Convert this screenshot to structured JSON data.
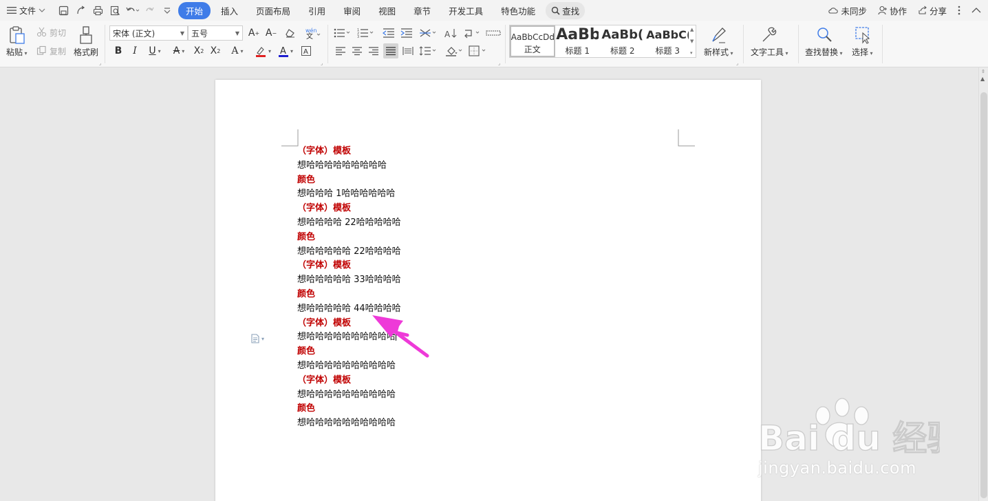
{
  "menu": {
    "file_label": "文件",
    "tabs": [
      "开始",
      "插入",
      "页面布局",
      "引用",
      "审阅",
      "视图",
      "章节",
      "开发工具",
      "特色功能"
    ],
    "active_tab": "开始",
    "search_label": "查找",
    "sync_label": "未同步",
    "collab_label": "协作",
    "share_label": "分享"
  },
  "ribbon": {
    "paste": "粘贴",
    "cut": "剪切",
    "copy": "复制",
    "format_painter": "格式刷",
    "font_name": "宋体 (正文)",
    "font_size": "五号",
    "styles": [
      {
        "preview": "AaBbCcDd",
        "name": "正文"
      },
      {
        "preview": "AaBb",
        "name": "标题 1"
      },
      {
        "preview": "AaBb(",
        "name": "标题 2"
      },
      {
        "preview": "AaBbC(",
        "name": "标题 3"
      }
    ],
    "new_style": "新样式",
    "text_tools": "文字工具",
    "find_replace": "查找替换",
    "select": "选择"
  },
  "document": {
    "lines": [
      {
        "text": "（字体）模板",
        "style": "red"
      },
      {
        "text": "想哈哈哈哈哈哈哈哈哈",
        "style": "black"
      },
      {
        "text": "颜色",
        "style": "red"
      },
      {
        "text": "想哈哈哈 1哈哈哈哈哈哈",
        "style": "black"
      },
      {
        "text": "（字体）模板",
        "style": "red"
      },
      {
        "text": "想哈哈哈哈 22哈哈哈哈哈",
        "style": "black"
      },
      {
        "text": "颜色",
        "style": "red"
      },
      {
        "text": "想哈哈哈哈哈 22哈哈哈哈",
        "style": "black"
      },
      {
        "text": "（字体）模板",
        "style": "red"
      },
      {
        "text": "想哈哈哈哈哈 33哈哈哈哈",
        "style": "black"
      },
      {
        "text": "颜色",
        "style": "red"
      },
      {
        "text": "想哈哈哈哈哈 44哈哈哈哈",
        "style": "black"
      },
      {
        "text": "（字体）模板",
        "style": "red"
      },
      {
        "text": "想哈哈哈哈哈哈哈哈哈哈",
        "style": "black"
      },
      {
        "text": "颜色",
        "style": "red"
      },
      {
        "text": "想哈哈哈哈哈哈哈哈哈哈",
        "style": "black"
      },
      {
        "text": "（字体）模板",
        "style": "red"
      },
      {
        "text": "想哈哈哈哈哈哈哈哈哈哈",
        "style": "black"
      },
      {
        "text": "颜色",
        "style": "red"
      },
      {
        "text": "想哈哈哈哈哈哈哈哈哈哈",
        "style": "black"
      }
    ],
    "caret_line": 13
  },
  "watermark": {
    "brand": "Bai du 经验",
    "url": "jingyan.baidu.com"
  },
  "colors": {
    "accent": "#3f7ce8",
    "heading_red": "#c00000",
    "arrow_magenta": "#ee3ad8"
  }
}
